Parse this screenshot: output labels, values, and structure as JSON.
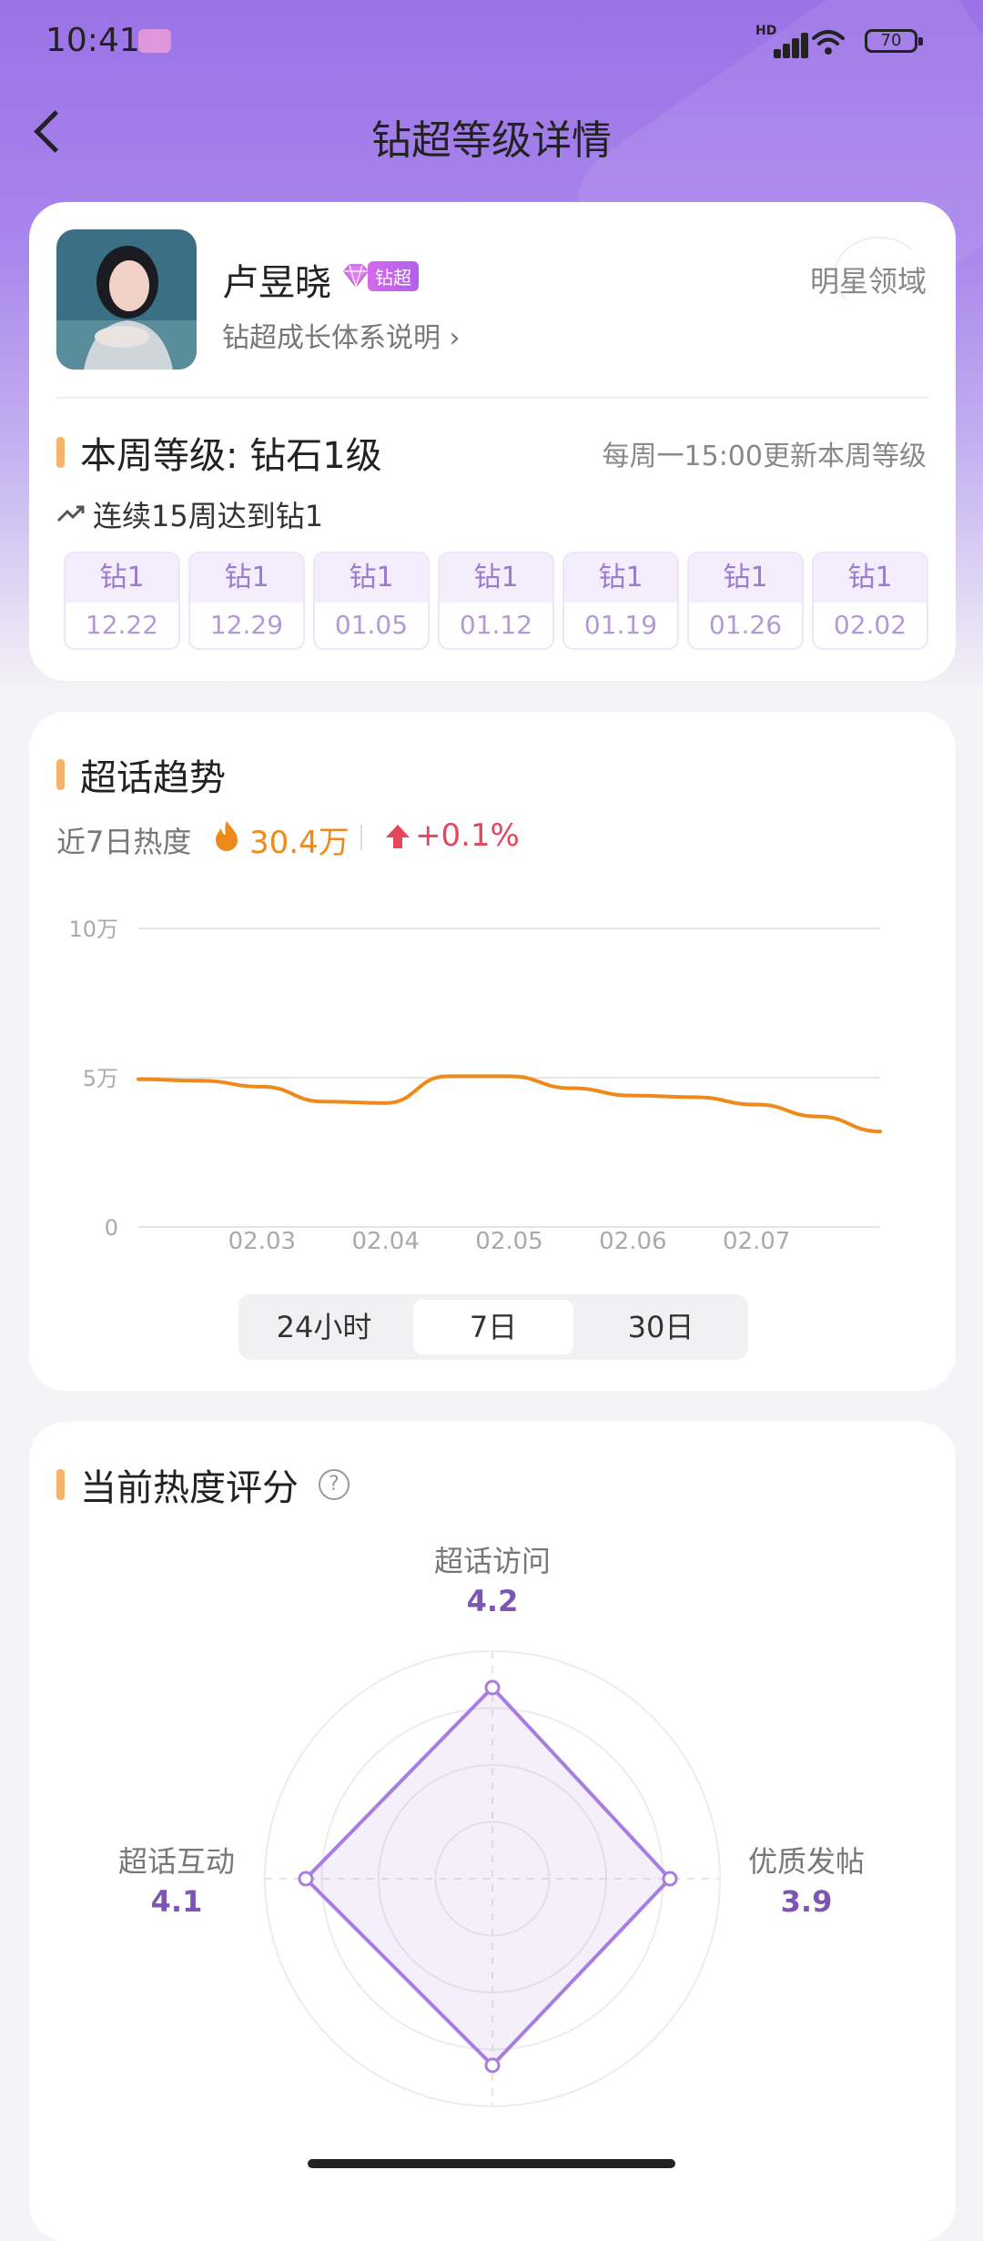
{
  "status_bar": {
    "time": "10:41",
    "hd": "HD",
    "battery": "70"
  },
  "header": {
    "title": "钻超等级详情"
  },
  "profile": {
    "name": "卢昱晓",
    "badge": "钻超",
    "system_link": "钻超成长体系说明 ›",
    "realm": "明星领域"
  },
  "level": {
    "title": "本周等级: 钻石1级",
    "note": "每周一15:00更新本周等级",
    "streak": "连续15周达到钻1",
    "weeks": [
      {
        "level": "钻1",
        "date": "12.22"
      },
      {
        "level": "钻1",
        "date": "12.29"
      },
      {
        "level": "钻1",
        "date": "01.05"
      },
      {
        "level": "钻1",
        "date": "01.12"
      },
      {
        "level": "钻1",
        "date": "01.19"
      },
      {
        "level": "钻1",
        "date": "01.26"
      },
      {
        "level": "钻1",
        "date": "02.02"
      }
    ]
  },
  "trend": {
    "title": "超话趋势",
    "heat_label": "近7日热度",
    "heat_value": "30.4万",
    "heat_change": "+0.1%",
    "tabs": [
      "24小时",
      "7日",
      "30日"
    ],
    "selected_tab": "7日"
  },
  "chart_data": {
    "type": "line",
    "title": "",
    "xlabel": "",
    "ylabel": "",
    "y_tick_labels": [
      "10万",
      "5万",
      "0"
    ],
    "y_ticks": [
      100000,
      50000,
      0
    ],
    "ylim": [
      0,
      100000
    ],
    "x_tick_labels": [
      "02.03",
      "02.04",
      "02.05",
      "02.06",
      "02.07"
    ],
    "x": [
      0,
      0.5,
      1,
      1.5,
      2,
      2.5,
      3,
      3.5,
      4,
      4.5,
      5,
      5.5,
      6
    ],
    "xlim": [
      0,
      6
    ],
    "series": [
      {
        "color": "#ee8a1a",
        "values": [
          49500,
          49000,
          47000,
          42000,
          41500,
          50500,
          50500,
          46500,
          44000,
          43500,
          41000,
          37000,
          32000
        ]
      }
    ],
    "grid": true
  },
  "score": {
    "title": "当前热度评分",
    "help": "?",
    "axes": [
      {
        "label": "超话访问",
        "value": "4.2",
        "score": 4.2
      },
      {
        "label": "优质发帖",
        "value": "3.9",
        "score": 3.9
      },
      {
        "label": "",
        "value": "",
        "score": 4.1
      },
      {
        "label": "超话互动",
        "value": "4.1",
        "score": 4.1
      }
    ],
    "max": 5
  },
  "colors": {
    "accent": "#9b7bcf",
    "orange": "#ee8a1a",
    "red": "#e6465a",
    "radar": "#a77ee0"
  }
}
